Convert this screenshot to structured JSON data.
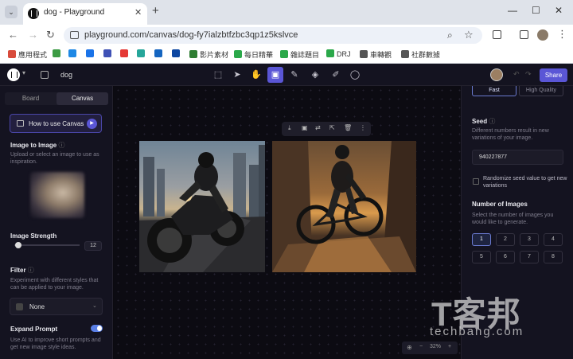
{
  "browser": {
    "tab_title": "dog - Playground",
    "url": "playground.com/canvas/dog-fy7ialzbtfzbc3qp1z5kslvce",
    "bookmarks": [
      {
        "label": "應用程式",
        "color": "#d84b3b"
      },
      {
        "label": "",
        "color": "#3c9b43"
      },
      {
        "label": "",
        "color": "#1e88e5"
      },
      {
        "label": "",
        "color": "#1a73e8"
      },
      {
        "label": "",
        "color": "#3f51b5"
      },
      {
        "label": "",
        "color": "#e53935"
      },
      {
        "label": "",
        "color": "#26a69a"
      },
      {
        "label": "",
        "color": "#1565c0"
      },
      {
        "label": "",
        "color": "#0d47a1"
      },
      {
        "label": "影片素材",
        "color": "#2e7d32"
      },
      {
        "label": "每日精華",
        "color": "#2ba84a"
      },
      {
        "label": "雜誌題目",
        "color": "#2ba84a"
      },
      {
        "label": "DRJ",
        "color": "#2ba84a"
      },
      {
        "label": "車轉觀",
        "color": "#555555"
      },
      {
        "label": "社群數據",
        "color": "#555555"
      }
    ]
  },
  "app": {
    "doc_title": "dog",
    "share_label": "Share",
    "accent": "#5a56d6",
    "tools": [
      "frame-tool-icon",
      "pointer-tool-icon",
      "hand-tool-icon",
      "image-tool-icon",
      "brush-tool-icon",
      "fill-tool-icon",
      "pencil-tool-icon",
      "comment-tool-icon"
    ]
  },
  "left_panel": {
    "tab_board": "Board",
    "tab_canvas": "Canvas",
    "how_to": "How to use Canvas",
    "image_to_image": "Image to Image",
    "image_hint": "Upload or select an image to use as inspiration.",
    "image_strength": "Image Strength",
    "image_strength_value": "12",
    "filter": "Filter",
    "filter_hint": "Experiment with different styles that can be applied to your image.",
    "filter_value": "None",
    "expand_prompt": "Expand Prompt",
    "expand_hint": "Use AI to improve short prompts and get new image style ideas."
  },
  "canvas": {
    "zoom": "32%"
  },
  "right_panel": {
    "quality_fast": "Fast",
    "quality_high": "High Quality",
    "seed": "Seed",
    "seed_hint": "Different numbers result in new variations of your image.",
    "seed_value": "940227877",
    "randomize": "Randomize seed value to get new variations",
    "num_images": "Number of Images",
    "num_hint": "Select the number of images you would like to generate.",
    "numbers": [
      "1",
      "2",
      "3",
      "4",
      "5",
      "6",
      "7",
      "8"
    ],
    "selected_number": "1"
  },
  "watermark": {
    "big": "T客邦",
    "small": "techbang.com"
  }
}
